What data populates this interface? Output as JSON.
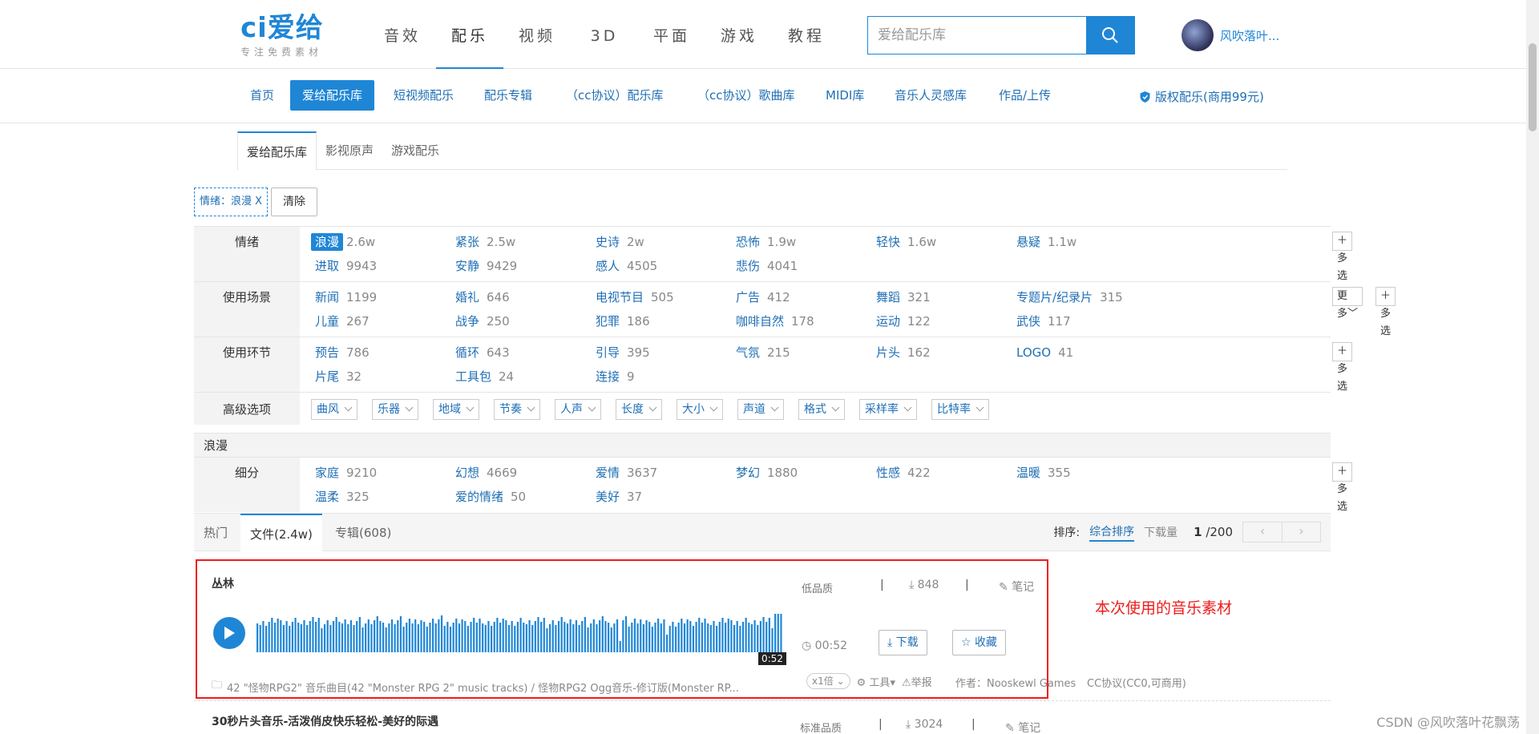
{
  "header": {
    "logo_text": "ci爱给",
    "logo_tagline": "专注免费素材",
    "nav": [
      "音效",
      "配乐",
      "视频",
      "3D",
      "平面",
      "游戏",
      "教程"
    ],
    "active_nav": 1,
    "search_placeholder": "爱给配乐库",
    "user_name": "风吹落叶..."
  },
  "subnav": {
    "items": [
      "首页",
      "爱给配乐库",
      "短视频配乐",
      "配乐专辑",
      "（cc协议）配乐库",
      "（cc协议）歌曲库",
      "MIDI库",
      "音乐人灵感库",
      "作品/上传"
    ],
    "active": 1,
    "copyright": "版权配乐(商用99元)"
  },
  "lib_tabs": [
    "爱给配乐库",
    "影视原声",
    "游戏配乐"
  ],
  "filter_chip": "情绪：浪漫 X",
  "clear_label": "清除",
  "multi_label": "多选",
  "more_label": "更多",
  "filters": {
    "mood": {
      "label": "情绪",
      "items": [
        {
          "name": "浪漫",
          "count": "2.6w"
        },
        {
          "name": "紧张",
          "count": "2.5w"
        },
        {
          "name": "史诗",
          "count": "2w"
        },
        {
          "name": "恐怖",
          "count": "1.9w"
        },
        {
          "name": "轻快",
          "count": "1.6w"
        },
        {
          "name": "悬疑",
          "count": "1.1w"
        },
        {
          "name": "进取",
          "count": "9943"
        },
        {
          "name": "安静",
          "count": "9429"
        },
        {
          "name": "感人",
          "count": "4505"
        },
        {
          "name": "悲伤",
          "count": "4041"
        }
      ]
    },
    "scene": {
      "label": "使用场景",
      "items": [
        {
          "name": "新闻",
          "count": "1199"
        },
        {
          "name": "婚礼",
          "count": "646"
        },
        {
          "name": "电视节目",
          "count": "505"
        },
        {
          "name": "广告",
          "count": "412"
        },
        {
          "name": "舞蹈",
          "count": "321"
        },
        {
          "name": "专题片/纪录片",
          "count": "315"
        },
        {
          "name": "儿童",
          "count": "267"
        },
        {
          "name": "战争",
          "count": "250"
        },
        {
          "name": "犯罪",
          "count": "186"
        },
        {
          "name": "咖啡自然",
          "count": "178"
        },
        {
          "name": "运动",
          "count": "122"
        },
        {
          "name": "武侠",
          "count": "117"
        }
      ]
    },
    "segment": {
      "label": "使用环节",
      "items": [
        {
          "name": "预告",
          "count": "786"
        },
        {
          "name": "循环",
          "count": "643"
        },
        {
          "name": "引导",
          "count": "395"
        },
        {
          "name": "气氛",
          "count": "215"
        },
        {
          "name": "片头",
          "count": "162"
        },
        {
          "name": "LOGO",
          "count": "41"
        },
        {
          "name": "片尾",
          "count": "32"
        },
        {
          "name": "工具包",
          "count": "24"
        },
        {
          "name": "连接",
          "count": "9"
        }
      ]
    },
    "advanced": {
      "label": "高级选项",
      "options": [
        "曲风",
        "乐器",
        "地域",
        "节奏",
        "人声",
        "长度",
        "大小",
        "声道",
        "格式",
        "采样率",
        "比特率"
      ]
    },
    "romance_header": "浪漫",
    "sub": {
      "label": "细分",
      "items": [
        {
          "name": "家庭",
          "count": "9210"
        },
        {
          "name": "幻想",
          "count": "4669"
        },
        {
          "name": "爱情",
          "count": "3637"
        },
        {
          "name": "梦幻",
          "count": "1880"
        },
        {
          "name": "性感",
          "count": "422"
        },
        {
          "name": "温暖",
          "count": "355"
        },
        {
          "name": "温柔",
          "count": "325"
        },
        {
          "name": "爱的情绪",
          "count": "50"
        },
        {
          "name": "美好",
          "count": "37"
        }
      ]
    }
  },
  "results": {
    "tabs": [
      "热门",
      "文件(2.4w)",
      "专辑(608)"
    ],
    "active_tab": 1,
    "sort_label": "排序:",
    "sort_options": [
      "综合排序",
      "下载量"
    ],
    "active_sort": 0,
    "page_current": "1",
    "page_total": "/200"
  },
  "track": {
    "title": "丛林",
    "quality": "低品质",
    "downloads": "848",
    "note": "笔记",
    "duration": "00:52",
    "wave_time": "0:52",
    "download_btn": "下载",
    "collect_btn": "收藏",
    "album": "42 \"怪物RPG2\" 音乐曲目(42 \"Monster RPG 2\" music tracks) / 怪物RPG2 Ogg音乐-修订版(Monster RP...",
    "speed": "x1倍",
    "tools": "工具",
    "report": "举报",
    "author": "作者：Nooskewl Games",
    "license": "CC协议(CC0,可商用)"
  },
  "annotation": "本次使用的音乐素材",
  "next_track": {
    "title": "30秒片头音乐-活泼俏皮快乐轻松-美好的际遇",
    "quality": "标准品质",
    "downloads": "3024",
    "note": "笔记"
  },
  "watermark": "CSDN @风吹落叶花飘荡",
  "colors": {
    "accent": "#1f86d6",
    "highlight_border": "#ee1c1c"
  }
}
